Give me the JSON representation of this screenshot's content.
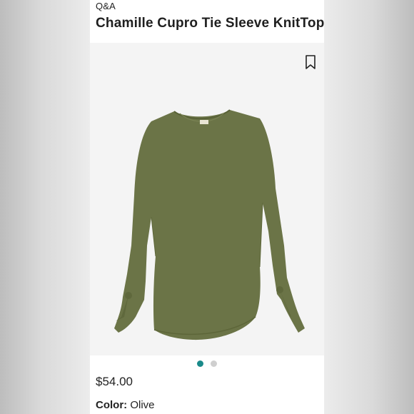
{
  "header": {
    "section_label": "Q&A",
    "product_title": "Chamille Cupro Tie Sleeve KnitTop"
  },
  "gallery": {
    "bookmark_icon": "bookmark-icon",
    "image_alt": "olive tie sleeve knit top",
    "total_images": 2,
    "active_index": 0
  },
  "details": {
    "price": "$54.00",
    "color_label": "Color:",
    "color_value": "Olive"
  },
  "colors": {
    "shirt": "#6b7447",
    "accent_dot": "#1a8a8a"
  }
}
